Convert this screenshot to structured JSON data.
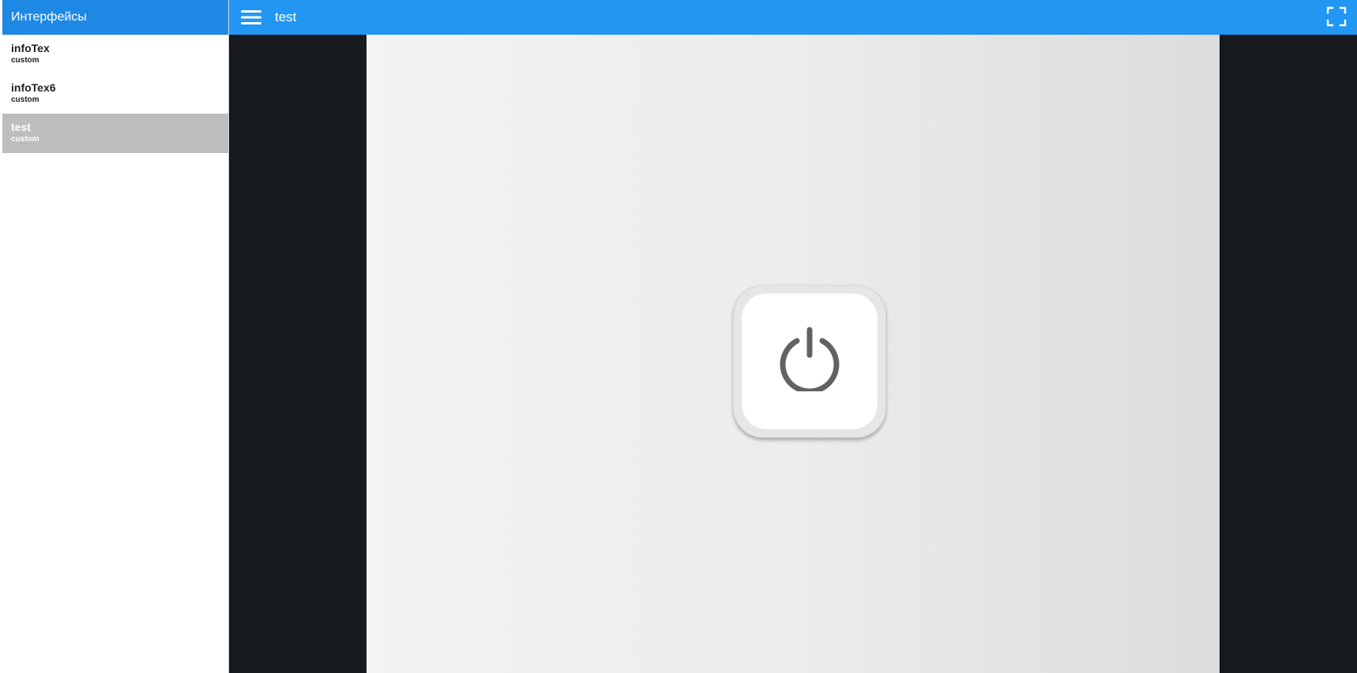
{
  "sidebar": {
    "header": "Интерфейсы",
    "items": [
      {
        "name": "infoTex",
        "type": "custom"
      },
      {
        "name": "infoTex6",
        "type": "custom"
      },
      {
        "name": "test",
        "type": "custom"
      }
    ],
    "active_index": 2
  },
  "topbar": {
    "title": "test",
    "menu_icon": "hamburger-menu-icon",
    "fullscreen_icon": "fullscreen-icon"
  },
  "main": {
    "power_icon": "power-icon"
  },
  "colors": {
    "sidebar_header": "#1e88e5",
    "topbar": "#2196f3",
    "active_item": "#bdbdbd",
    "content_background": "#16191d",
    "power_icon": "#606366"
  }
}
